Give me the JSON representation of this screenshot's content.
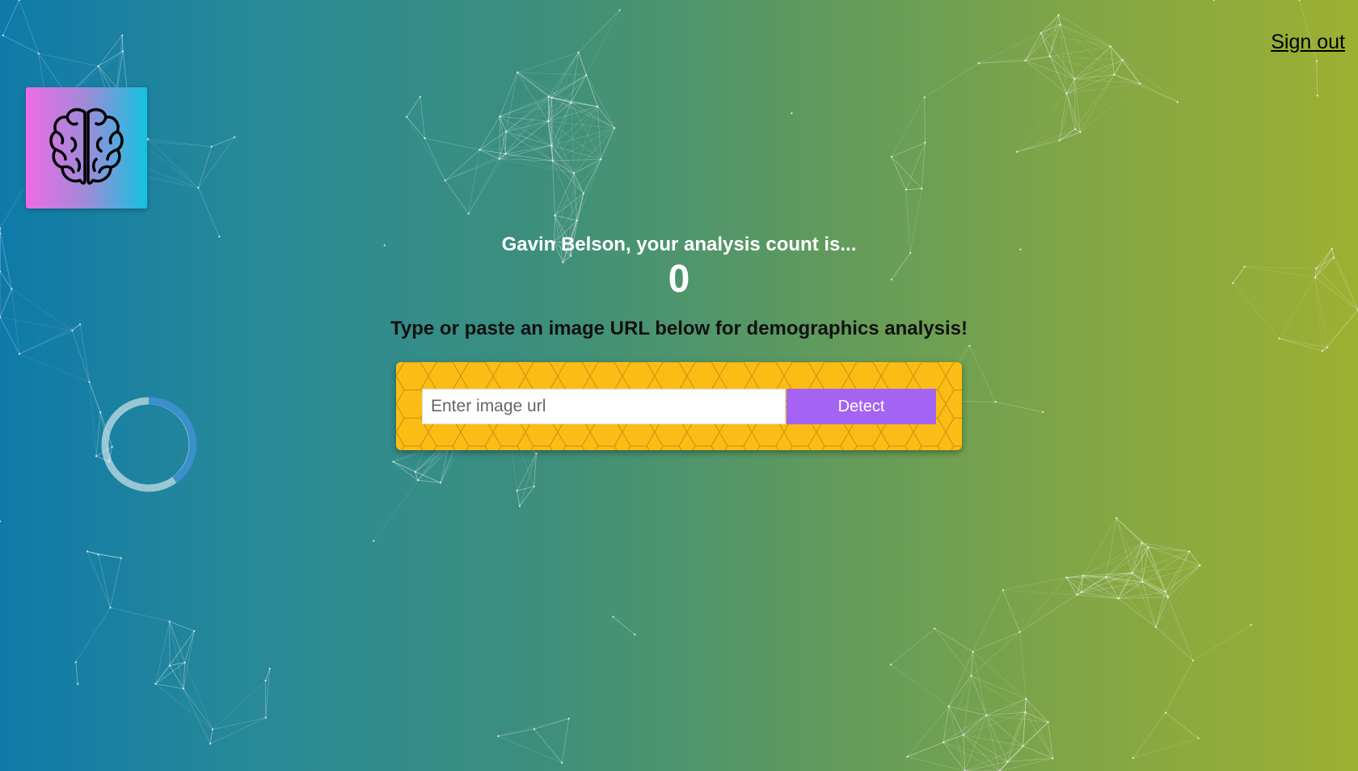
{
  "nav": {
    "signout_label": "Sign out"
  },
  "logo": {
    "icon": "brain-icon",
    "gradient": [
      "#ee6be6",
      "#12c3e0"
    ]
  },
  "loader": {
    "icon": "loading-spinner-icon"
  },
  "rank": {
    "greeting": "Gavin Belson, your analysis count is...",
    "count": "0"
  },
  "form": {
    "prompt": "Type or paste an image URL below for demographics analysis!",
    "input_placeholder": "Enter image url",
    "input_value": "",
    "button_label": "Detect"
  },
  "colors": {
    "form_background": "#fbbd15",
    "button": "#a463f2",
    "bg_left": "#0f7aaa",
    "bg_right": "#9db032"
  }
}
